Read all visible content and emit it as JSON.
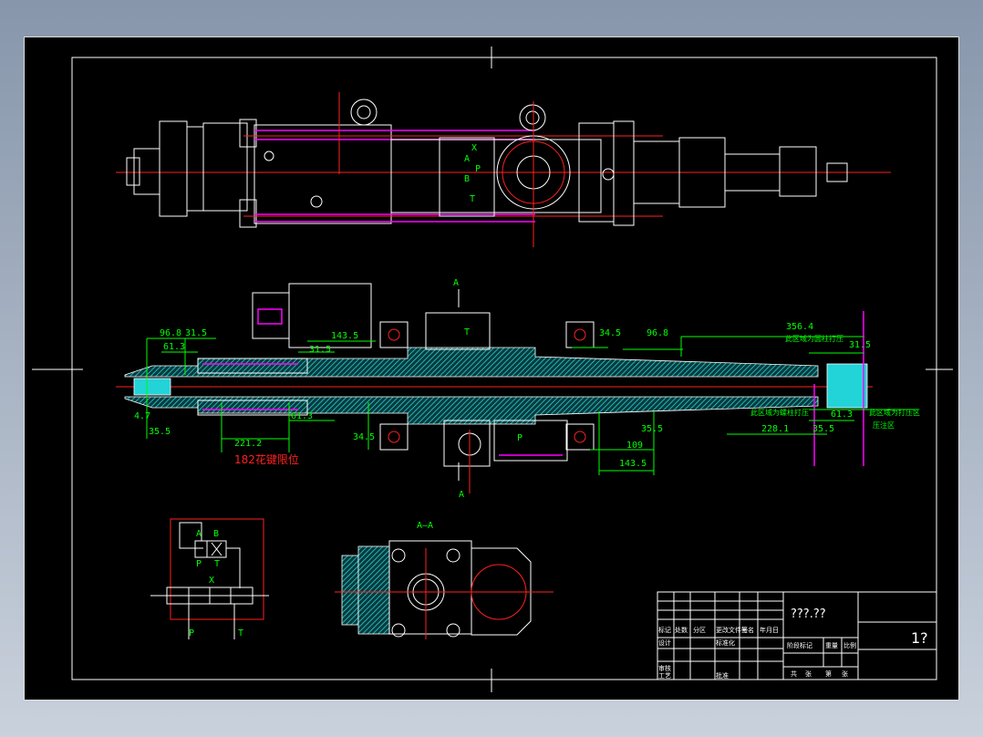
{
  "colors": {
    "background": "#000000",
    "outline": "#ffffff",
    "centerline": "#ff2020",
    "dimension": "#00ff00",
    "hatch": "#22d3d8",
    "highlight": "#ff00ff"
  },
  "top_view": {
    "port_labels": [
      "X",
      "A",
      "P",
      "B",
      "T"
    ]
  },
  "section_view": {
    "section_mark": "A",
    "port_labels": [
      "T",
      "P"
    ],
    "dimensions_left": [
      "96.8",
      "31.5",
      "61.3",
      "4.7",
      "35.5",
      "143.5",
      "31.5",
      "61.3",
      "221.2",
      "34.5"
    ],
    "dimensions_right": [
      "34.5",
      "96.8",
      "356.4",
      "31.5",
      "35.5",
      "109",
      "143.5",
      "228.1",
      "35.5",
      "61.3"
    ],
    "note_red": "182花键限位",
    "notes_green": [
      "此区域为圆柱打压",
      "此区域为螺柱打压",
      "此区域为打压区",
      "压注区"
    ]
  },
  "schematic": {
    "labels": [
      "A",
      "B",
      "P",
      "T",
      "X",
      "P",
      "T"
    ]
  },
  "section_aa": {
    "title": "A—A"
  },
  "title_block": {
    "drawing_name": "???.??",
    "drawing_number": "1?",
    "header_row": [
      "标记",
      "处数",
      "分区",
      "更改文件号",
      "签名",
      "年月日"
    ],
    "left_labels": [
      "设计",
      "标准化",
      "审核",
      "工艺",
      "批准"
    ],
    "mid_labels": [
      "阶段标记",
      "重量",
      "比例"
    ],
    "bottom_labels": [
      "共",
      "张",
      "第",
      "张"
    ]
  }
}
